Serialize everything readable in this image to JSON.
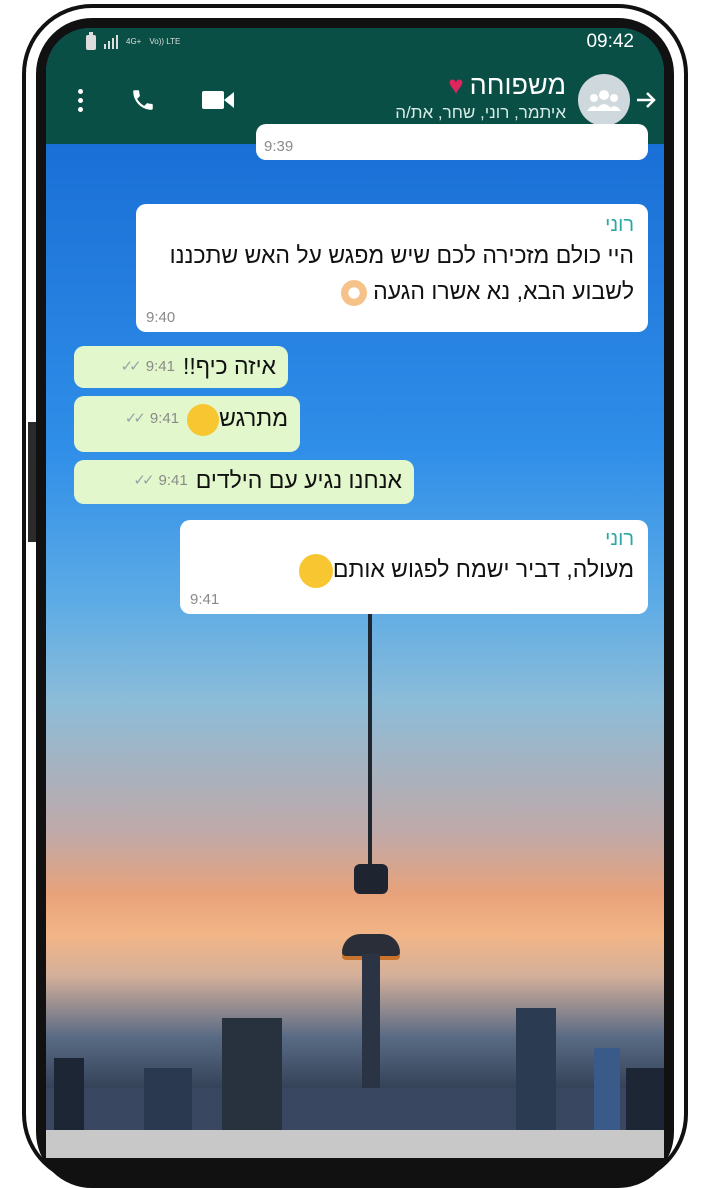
{
  "status_bar": {
    "time": "09:42",
    "network_label": "4G+",
    "volte_label": "Vo)) LTE"
  },
  "header": {
    "title": "משפוחה",
    "members": "איתמר, רוני, שחר, את/ה",
    "icons": {
      "more": "more-vert-icon",
      "call": "phone-icon",
      "video": "videocam-icon",
      "back": "arrow-back-icon",
      "avatar": "group-avatar-icon"
    }
  },
  "messages": [
    {
      "type": "in",
      "sender": "",
      "text": "",
      "time": "9:39"
    },
    {
      "type": "in",
      "sender": "רוני",
      "text": "היי כולם מזכירה לכם שיש מפגש על האש שתכננו לשבוע הבא, נא אשרו הגעה 👌",
      "time": "9:40"
    },
    {
      "type": "out",
      "text": "איזה כיף!!",
      "time": "9:41"
    },
    {
      "type": "out",
      "text": "מתרגש🤩",
      "time": "9:41"
    },
    {
      "type": "out",
      "text": "אנחנו נגיע עם הילדים",
      "time": "9:41"
    },
    {
      "type": "in",
      "sender": "רוני",
      "text": "מעולה, דביר ישמח לפגוש אותם😊",
      "time": "9:41"
    }
  ],
  "colors": {
    "header_bg": "#0a4f45",
    "outgoing_bubble": "#e2f7cb",
    "incoming_bubble": "#ffffff",
    "sender_name": "#2aa9a2"
  }
}
